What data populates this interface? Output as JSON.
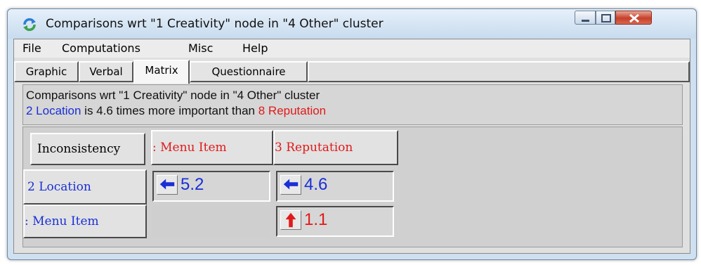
{
  "window": {
    "title": "Comparisons wrt \"1 Creativity\" node in \"4 Other\" cluster",
    "controls": {
      "minimize": "minimize",
      "maximize": "maximize",
      "close": "close"
    }
  },
  "menu": {
    "items": [
      "File",
      "Computations",
      "Misc",
      "Help"
    ]
  },
  "tabs": {
    "items": [
      "Graphic",
      "Verbal",
      "Matrix",
      "Questionnaire"
    ],
    "active": "Matrix"
  },
  "info": {
    "line1": "Comparisons wrt \"1 Creativity\" node in \"4 Other\" cluster",
    "line2": {
      "subject": "2 Location",
      "middle": " is 4.6 times more important than ",
      "object": "8 Reputation"
    }
  },
  "matrix": {
    "corner_button": "Inconsistency",
    "column_headers": [
      ": Menu Item",
      "3 Reputation"
    ],
    "row_headers": [
      "2 Location",
      ": Menu Item"
    ],
    "cells": [
      {
        "row": 0,
        "col": 0,
        "value": "5.2",
        "direction": "left",
        "color": "#1a2fd6"
      },
      {
        "row": 0,
        "col": 1,
        "value": "4.6",
        "direction": "left",
        "color": "#1a2fd6"
      },
      {
        "row": 1,
        "col": 1,
        "value": "1.1",
        "direction": "up",
        "color": "#e01a1a"
      }
    ]
  },
  "colors": {
    "blue_text": "#1a2fd6",
    "red_text": "#e01a1a"
  }
}
